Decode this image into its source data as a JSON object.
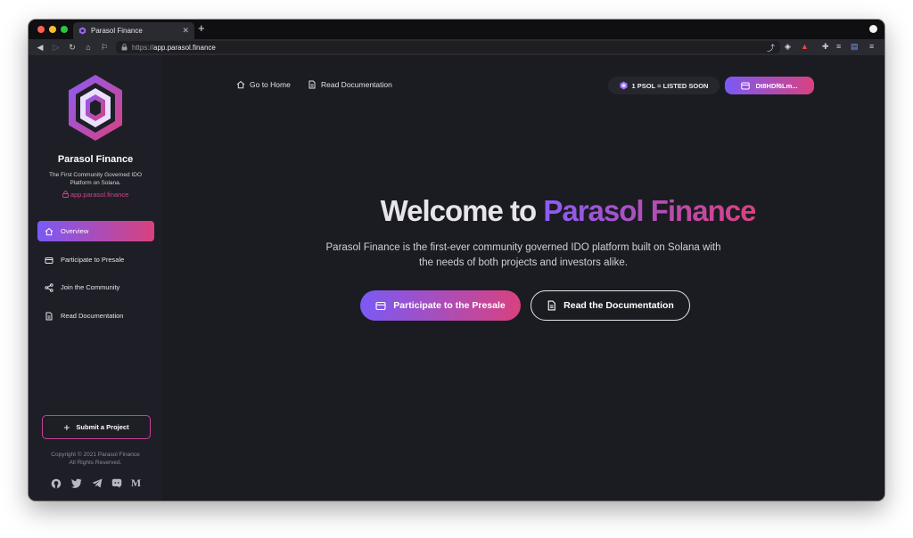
{
  "browser": {
    "tab_title": "Parasol Finance",
    "tab_close": "✕",
    "new_tab": "+",
    "url_scheme": "https://",
    "url_host": "app.parasol.finance"
  },
  "sidebar": {
    "brand": "Parasol Finance",
    "tagline": "The First Community Governed IDO Platform on Solana.",
    "site_link": "app.parasol.finance",
    "items": [
      {
        "label": "Overview",
        "icon": "home-icon"
      },
      {
        "label": "Participate to Presale",
        "icon": "wallet-icon"
      },
      {
        "label": "Join the Community",
        "icon": "share-icon"
      },
      {
        "label": "Read Documentation",
        "icon": "document-icon"
      }
    ],
    "submit_label": "Submit a Project",
    "copyright_line1": "Copyright © 2021 Parasol Finance",
    "copyright_line2": "All Rights Reserved.",
    "social": [
      "github-icon",
      "twitter-icon",
      "telegram-icon",
      "discord-icon",
      "medium-icon"
    ]
  },
  "topnav": {
    "home_label": "Go to Home",
    "docs_label": "Read Documentation",
    "price_label": "1 PSOL = LISTED SOON",
    "wallet_label": "Dt8HDf6Lm..."
  },
  "hero": {
    "title_plain": "Welcome to ",
    "title_accent": "Parasol Finance",
    "description": "Parasol Finance is the first-ever community governed IDO platform built on Solana with the needs of both projects and investors alike.",
    "primary_button": "Participate to the Presale",
    "secondary_button": "Read the Documentation"
  },
  "colors": {
    "accent_start": "#7a5af5",
    "accent_end": "#d9417f",
    "background": "#1b1c22",
    "sidebar": "#1e1f26"
  }
}
